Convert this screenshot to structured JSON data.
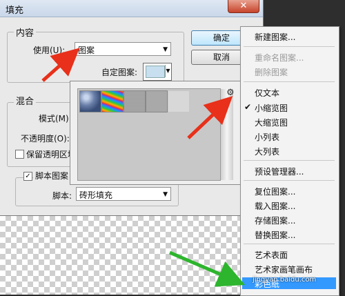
{
  "dialog": {
    "title": "填充",
    "close_glyph": "✕",
    "content_group": {
      "legend": "内容",
      "use_label": "使用(U):",
      "use_value": "图案",
      "custom_pattern_label": "自定图案:"
    },
    "blend_group": {
      "legend": "混合",
      "mode_label": "模式(M):",
      "opacity_label": "不透明度(O):",
      "preserve_transparency_label": "保留透明区域"
    },
    "script_group": {
      "checkbox_label": "脚本图案",
      "script_label": "脚本:",
      "script_value": "砖形填充"
    },
    "ok_label": "确定",
    "cancel_label": "取消"
  },
  "pattern_picker": {
    "gear_icon": "⚙",
    "thumbnails": [
      "bubbles",
      "rainbow",
      "gray-noise",
      "gray-fabric",
      "light-gray"
    ]
  },
  "context_menu": {
    "items": [
      {
        "label": "新建图案...",
        "disabled": false
      },
      {
        "label": "重命名图案...",
        "disabled": true
      },
      {
        "label": "删除图案",
        "disabled": true
      },
      {
        "label": "仅文本",
        "disabled": false
      },
      {
        "label": "小缩览图",
        "disabled": false,
        "checked": true
      },
      {
        "label": "大缩览图",
        "disabled": false
      },
      {
        "label": "小列表",
        "disabled": false
      },
      {
        "label": "大列表",
        "disabled": false
      },
      {
        "label": "预设管理器...",
        "disabled": false
      },
      {
        "label": "复位图案...",
        "disabled": false
      },
      {
        "label": "载入图案...",
        "disabled": false
      },
      {
        "label": "存储图案...",
        "disabled": false
      },
      {
        "label": "替换图案...",
        "disabled": false
      },
      {
        "label": "艺术表面",
        "disabled": false
      },
      {
        "label": "艺术家画笔画布",
        "disabled": false
      },
      {
        "label": "彩色纸",
        "disabled": false,
        "highlighted": true
      }
    ],
    "check_glyph": "✔"
  },
  "watermark": "jingyan.baidu.com",
  "colors": {
    "highlight": "#3399ff",
    "arrow_red": "#e8301a",
    "arrow_green": "#2db52d"
  }
}
